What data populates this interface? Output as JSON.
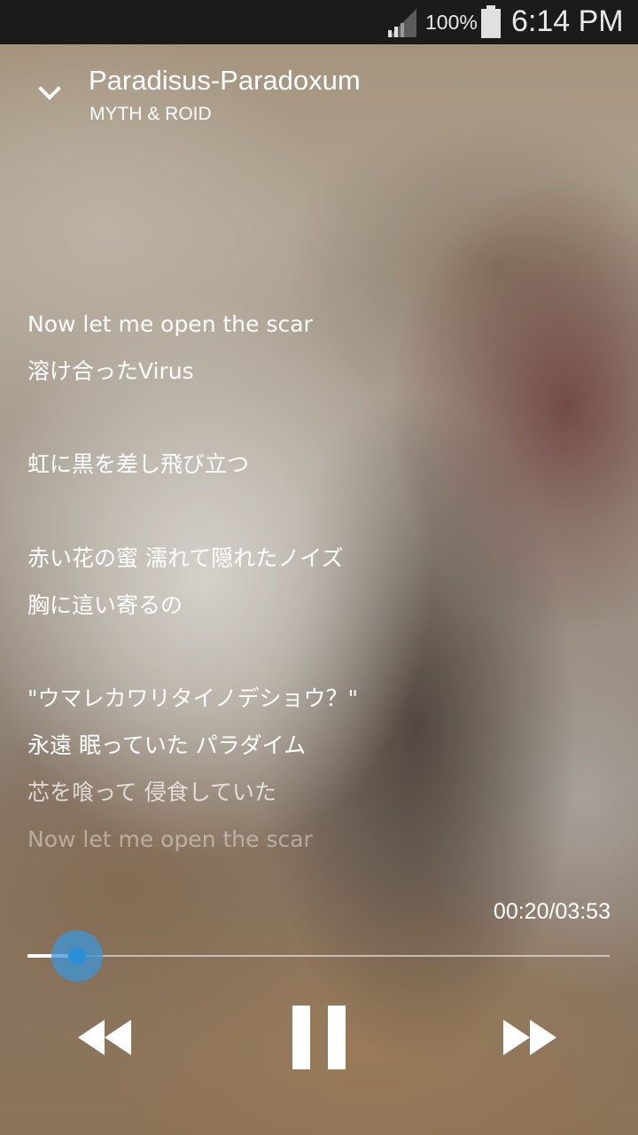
{
  "status_bar": {
    "battery_percent": "100%",
    "time": "6:14 PM",
    "icons": [
      "signal-icon",
      "battery-icon"
    ]
  },
  "now_playing": {
    "title": "Paradisus-Paradoxum",
    "artist": "MYTH & ROID",
    "collapse_icon": "chevron-down-icon"
  },
  "lyrics": [
    "Now let me open the scar",
    "溶け合ったVirus",
    "",
    "虹に黒を差し飛び立つ",
    "",
    "赤い花の蜜 濡れて隠れたノイズ",
    "胸に這い寄るの",
    "",
    "\"ウマレカワリタイノデショウ？\"",
    "永遠 眠っていた パラダイム",
    "芯を喰って 侵食していた",
    "Now let me open the scar"
  ],
  "playback": {
    "time_display": "00:20/03:53",
    "progress_fraction": 0.0858,
    "accent_color": "#2d8fd8"
  },
  "controls": {
    "rewind_icon": "rewind-icon",
    "pause_icon": "pause-icon",
    "forward_icon": "fast-forward-icon"
  }
}
